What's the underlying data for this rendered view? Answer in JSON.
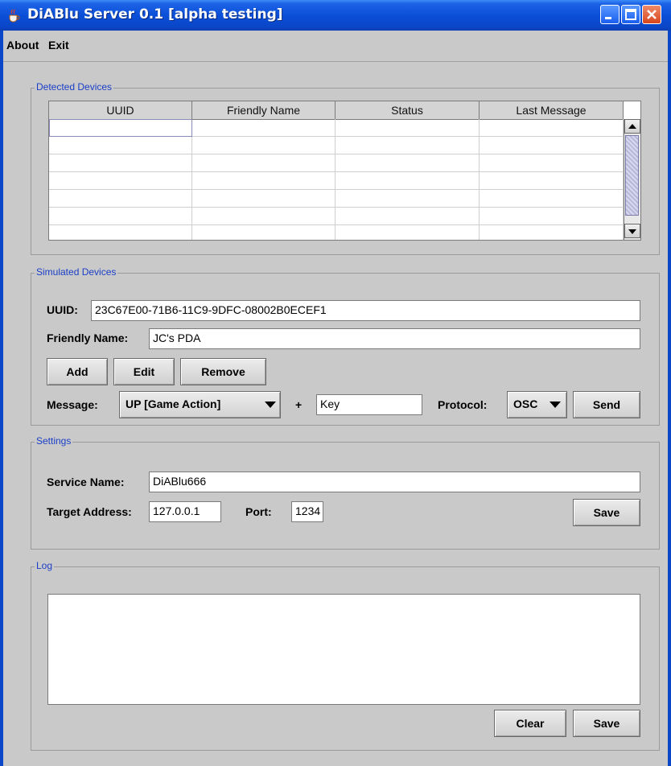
{
  "window": {
    "title": "DiABlu Server 0.1 [alpha testing]"
  },
  "menu": {
    "items": [
      "About",
      "Exit"
    ]
  },
  "detected": {
    "group_title": "Detected Devices",
    "columns": [
      "UUID",
      "Friendly Name",
      "Status",
      "Last Message"
    ]
  },
  "simulated": {
    "group_title": "Simulated Devices",
    "uuid_label": "UUID:",
    "uuid_value": "23C67E00-71B6-11C9-9DFC-08002B0ECEF1",
    "friendly_label": "Friendly Name:",
    "friendly_value": "JC's PDA",
    "add_label": "Add",
    "edit_label": "Edit",
    "remove_label": "Remove",
    "message_label": "Message:",
    "message_value": "UP [Game Action]",
    "plus": "+",
    "key_value": "Key",
    "protocol_label": "Protocol:",
    "protocol_value": "OSC",
    "send_label": "Send"
  },
  "settings": {
    "group_title": "Settings",
    "service_label": "Service Name:",
    "service_value": "DiABlu666",
    "target_label": "Target Address:",
    "target_value": "127.0.0.1",
    "port_label": "Port:",
    "port_value": "1234",
    "save_label": "Save"
  },
  "log": {
    "group_title": "Log",
    "clear_label": "Clear",
    "save_label": "Save"
  },
  "icons": {
    "app": "java-cup-icon",
    "minimize": "minimize-icon",
    "maximize": "maximize-icon",
    "close": "close-icon"
  },
  "colors": {
    "titlebar": "#0b4fd8",
    "panel": "#c9c9c9",
    "group_title": "#1a3ec8"
  }
}
